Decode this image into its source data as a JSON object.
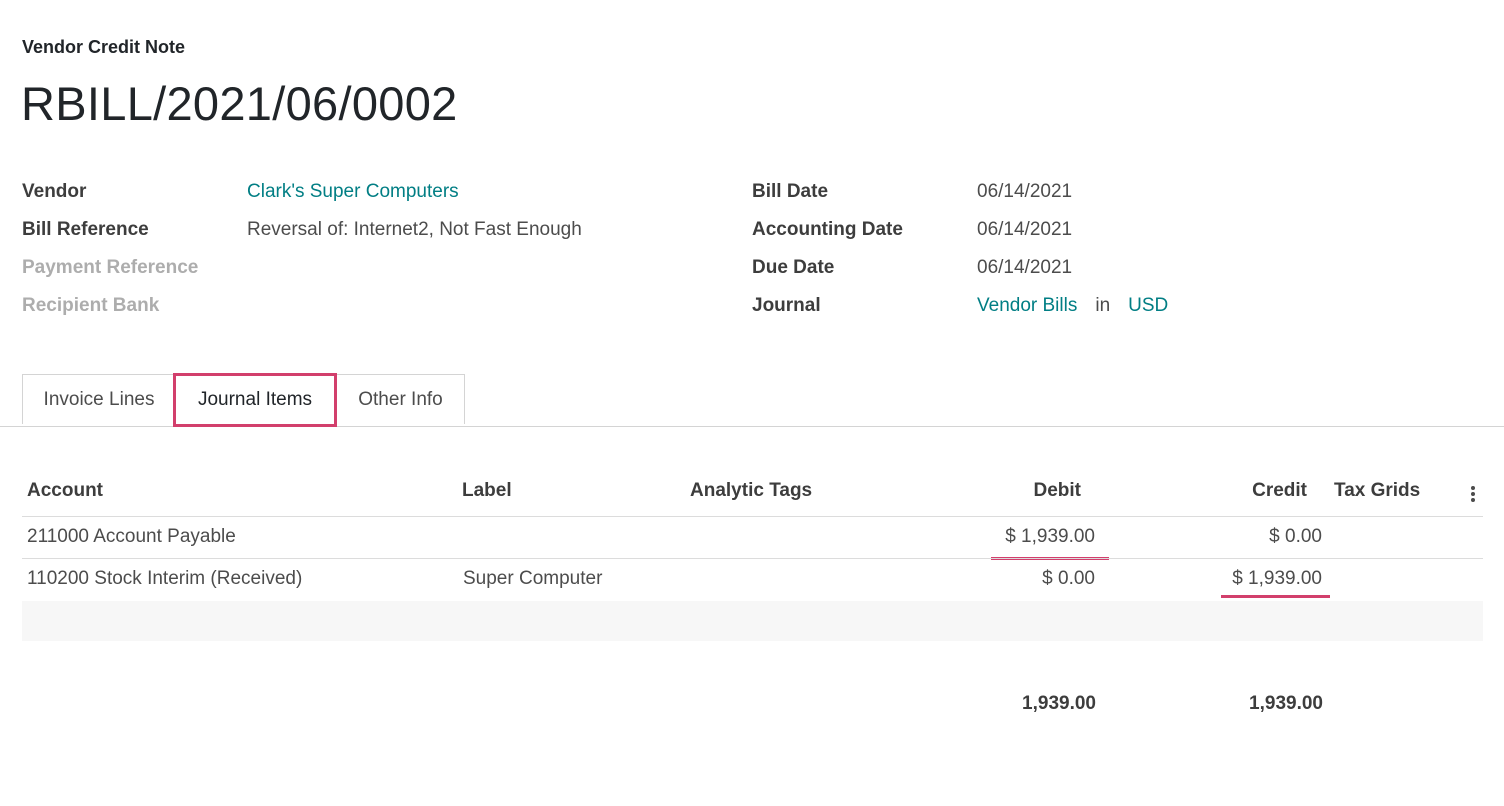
{
  "header": {
    "doc_type": "Vendor Credit Note",
    "title": "RBILL/2021/06/0002"
  },
  "left_fields": [
    {
      "label": "Vendor",
      "value": "Clark's Super Computers"
    },
    {
      "label": "Bill Reference",
      "value": "Reversal of: Internet2, Not Fast Enough"
    },
    {
      "label": "Payment Reference",
      "value": ""
    },
    {
      "label": "Recipient Bank",
      "value": ""
    }
  ],
  "right_fields": [
    {
      "label": "Bill Date",
      "value": "06/14/2021"
    },
    {
      "label": "Accounting Date",
      "value": "06/14/2021"
    },
    {
      "label": "Due Date",
      "value": "06/14/2021"
    },
    {
      "label": "Journal",
      "value": "Vendor Bills",
      "in": "in",
      "currency": "USD"
    }
  ],
  "tabs": [
    {
      "label": "Invoice Lines"
    },
    {
      "label": "Journal Items",
      "active": true
    },
    {
      "label": "Other Info"
    }
  ],
  "table": {
    "columns": [
      "Account",
      "Label",
      "Analytic Tags",
      "Debit",
      "Credit",
      "Tax Grids"
    ],
    "rows": [
      {
        "account": "211000 Account Payable",
        "label": "",
        "tags": "",
        "debit": "$ 1,939.00",
        "credit": "$ 0.00",
        "tax_grids": ""
      },
      {
        "account": "110200 Stock Interim (Received)",
        "label": "Super Computer",
        "tags": "",
        "debit": "$ 0.00",
        "credit": "$ 1,939.00",
        "tax_grids": ""
      }
    ],
    "totals": {
      "debit": "1,939.00",
      "credit": "1,939.00"
    }
  },
  "colors": {
    "link": "#017e84",
    "highlight": "#d23f6c"
  }
}
